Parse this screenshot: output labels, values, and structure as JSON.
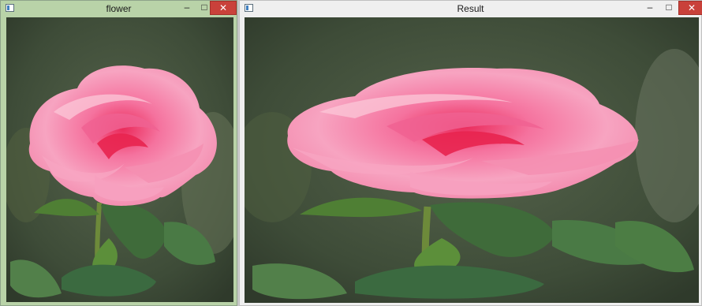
{
  "windows": {
    "flower": {
      "title": "flower",
      "minimize_glyph": "–",
      "maximize_glyph": "□",
      "close_glyph": "✕",
      "image_description": "pink-rose-photo"
    },
    "result": {
      "title": "Result",
      "minimize_glyph": "–",
      "maximize_glyph": "□",
      "close_glyph": "✕",
      "image_description": "pink-rose-photo-stretched"
    }
  },
  "colors": {
    "active_titlebar": "#b9d3a8",
    "inactive_titlebar": "#efefef",
    "close_button": "#c9413a",
    "rose_pink": "#f27ea6",
    "background_green": "#3b4a35"
  },
  "icons": {
    "app_icon": "window-app-icon",
    "minimize": "minimize-icon",
    "maximize": "maximize-icon",
    "close": "close-icon"
  }
}
